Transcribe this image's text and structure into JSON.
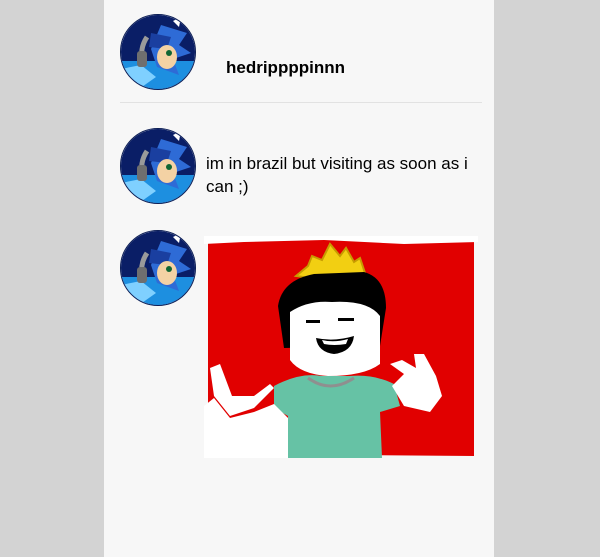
{
  "profile": {
    "username": "hedrippppinnn",
    "avatar_icon": "sonic-avatar-icon"
  },
  "messages": [
    {
      "type": "text",
      "text": "im in brazil but visiting as soon as i can ;)"
    },
    {
      "type": "image",
      "icon": "pixel-art-character-image"
    }
  ],
  "colors": {
    "page_bg": "#d3d3d3",
    "panel_bg": "#f7f7f7",
    "image_red": "#e10000",
    "shirt": "#66c2a5",
    "hair_yellow": "#f2cf12"
  }
}
